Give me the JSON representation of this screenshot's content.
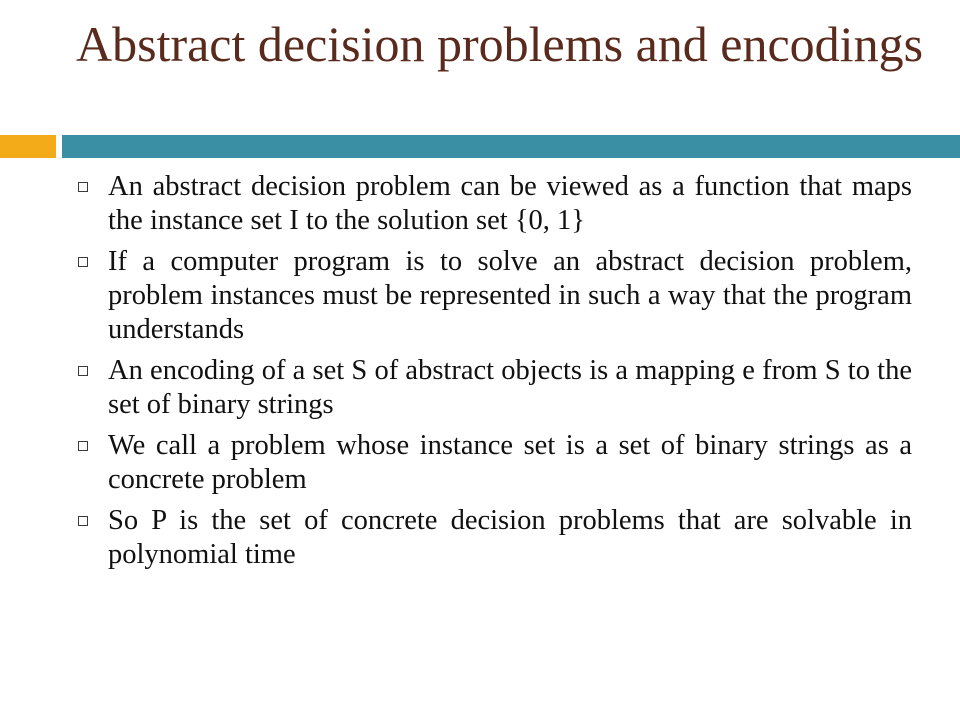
{
  "slide": {
    "title": "Abstract decision problems and encodings",
    "colors": {
      "title": "#5a2a1c",
      "accent_bar": "#f3ab1a",
      "main_bar": "#3a8fa5",
      "text": "#111111"
    },
    "bullet_icon": "hollow-square-bullet-icon",
    "bullets": [
      "An abstract decision problem can be viewed as a function that maps the instance set I to the solution set {0, 1}",
      "If a computer program is to solve an abstract decision problem, problem instances must be represented in such a way that the program understands",
      "An encoding of a set S of abstract objects is a mapping e from S to the set of binary strings",
      "We call a problem whose instance set is a set of binary strings as a concrete problem",
      "So P is the set of concrete decision problems that are solvable in polynomial time"
    ]
  }
}
